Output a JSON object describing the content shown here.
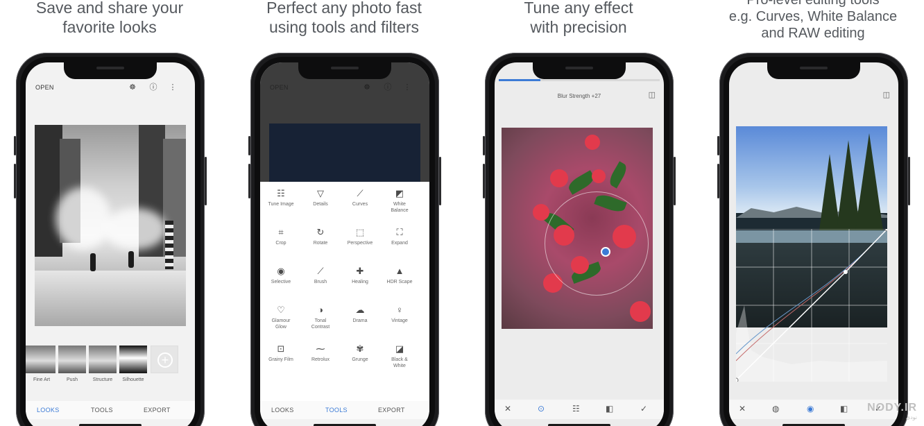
{
  "panels": [
    {
      "caption_lines": [
        "Save and share your",
        "favorite looks"
      ],
      "topbar": {
        "open_label": "OPEN"
      },
      "filmstrip_labels": [
        "Fine Art",
        "Push",
        "Structure",
        "Silhouette"
      ],
      "tabs": [
        "LOOKS",
        "TOOLS",
        "EXPORT"
      ],
      "active_tab": "LOOKS"
    },
    {
      "caption_lines": [
        "Perfect any photo fast",
        "using tools and filters"
      ],
      "topbar": {
        "open_label": "OPEN"
      },
      "tools": [
        [
          "Tune Image",
          "Details",
          "Curves",
          "White Balance"
        ],
        [
          "Crop",
          "Rotate",
          "Perspective",
          "Expand"
        ],
        [
          "Selective",
          "Brush",
          "Healing",
          "HDR Scape"
        ],
        [
          "Glamour Glow",
          "Tonal Contrast",
          "Drama",
          "Vintage"
        ],
        [
          "Grainy Film",
          "Retrolux",
          "Grunge",
          "Black & White"
        ]
      ],
      "tabs": [
        "LOOKS",
        "TOOLS",
        "EXPORT"
      ],
      "active_tab": "TOOLS"
    },
    {
      "caption_lines": [
        "Tune any effect",
        "with precision"
      ],
      "parameter": "Blur Strength +27",
      "progress": 0.26
    },
    {
      "caption_lines": [
        "Pro-level editing tools",
        "e.g. Curves, White Balance",
        "and RAW editing"
      ]
    }
  ],
  "watermark": {
    "text": "NODY.IR",
    "sub": "نودی"
  },
  "colors": {
    "accent": "#3c7bd6",
    "caption": "#55595e"
  },
  "icons": [
    "lookup-icon",
    "info-icon",
    "more-vert-icon",
    "close-icon",
    "target-icon",
    "sliders-icon",
    "brush-style-icon",
    "check-icon",
    "compare-icon",
    "eye-icon",
    "contrast-icon"
  ]
}
